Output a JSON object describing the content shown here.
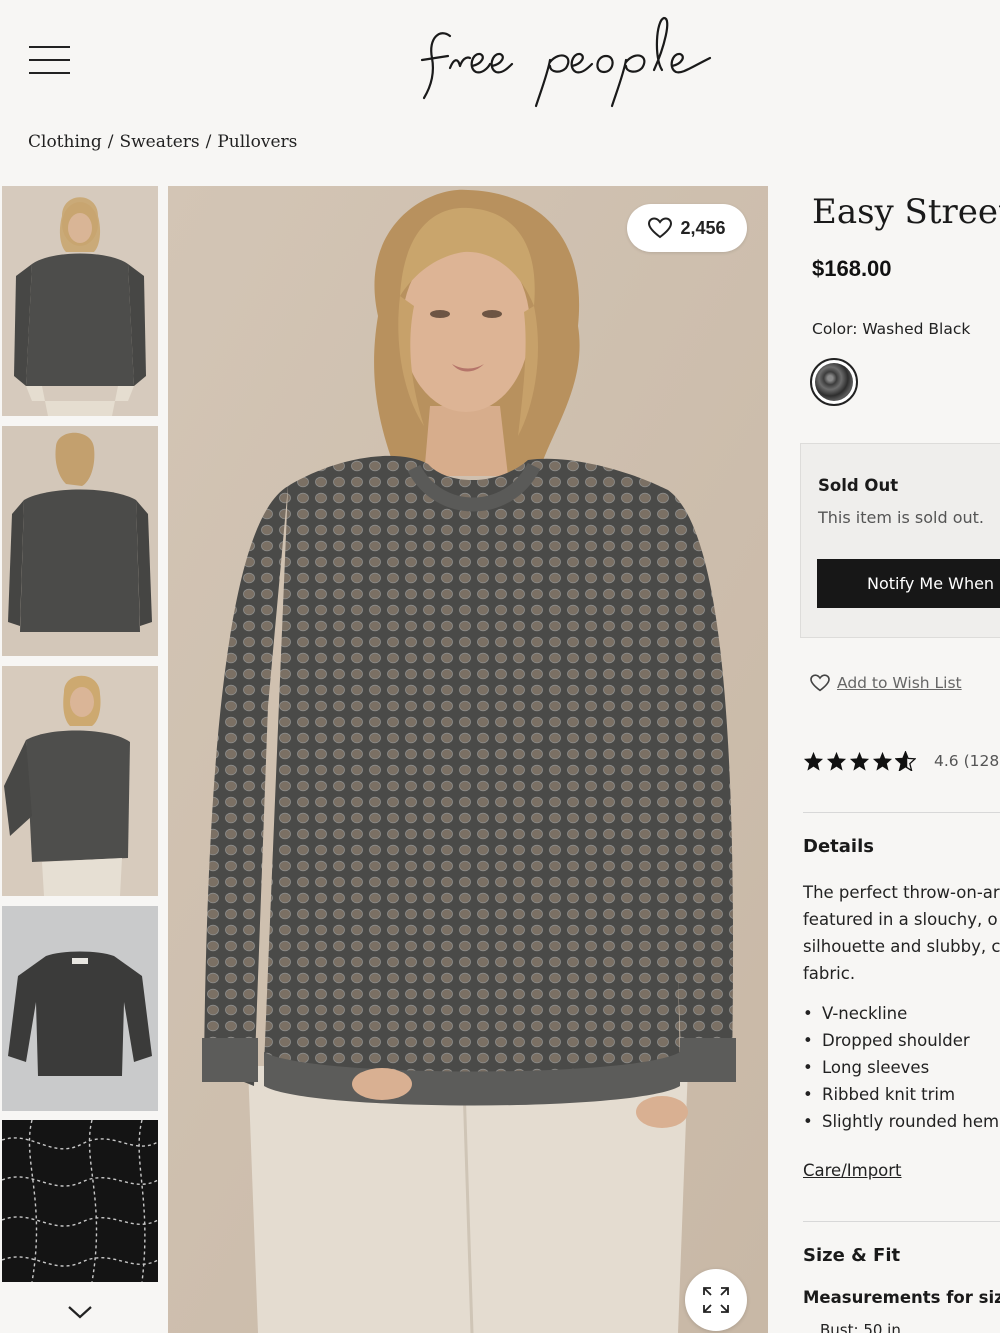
{
  "header": {
    "brand": "free people"
  },
  "breadcrumb": [
    "Clothing",
    "Sweaters",
    "Pullovers"
  ],
  "gallery": {
    "like_count": "2,456",
    "thumbnails": [
      "model-front",
      "model-back",
      "model-side",
      "flat-lay",
      "knit-detail"
    ]
  },
  "product": {
    "title": "Easy Street",
    "price": "$168.00",
    "color_label": "Color: Washed Black",
    "swatch_color": "#3c3c3c"
  },
  "availability": {
    "status": "Sold Out",
    "message": "This item is sold out.",
    "notify_label": "Notify Me When"
  },
  "wishlist_label": "Add to Wish List",
  "rating": {
    "stars": 4.6,
    "text": "4.6 (128"
  },
  "details": {
    "heading": "Details",
    "lines": [
      "The perfect throw-on-ar",
      "featured in a slouchy, o",
      "silhouette and slubby, c",
      "fabric."
    ],
    "bullets": [
      "V-neckline",
      "Dropped shoulder",
      "Long sleeves",
      "Ribbed knit trim",
      "Slightly rounded hem"
    ],
    "care_link": "Care/Import"
  },
  "size_fit": {
    "heading": "Size & Fit",
    "measurements_label": "Measurements for size",
    "bust": "Bust: 50 in"
  },
  "colors": {
    "accent": "#171717",
    "background": "#f7f6f4",
    "sweater": "#4a4a48",
    "backdrop": "#d8cbbd"
  }
}
